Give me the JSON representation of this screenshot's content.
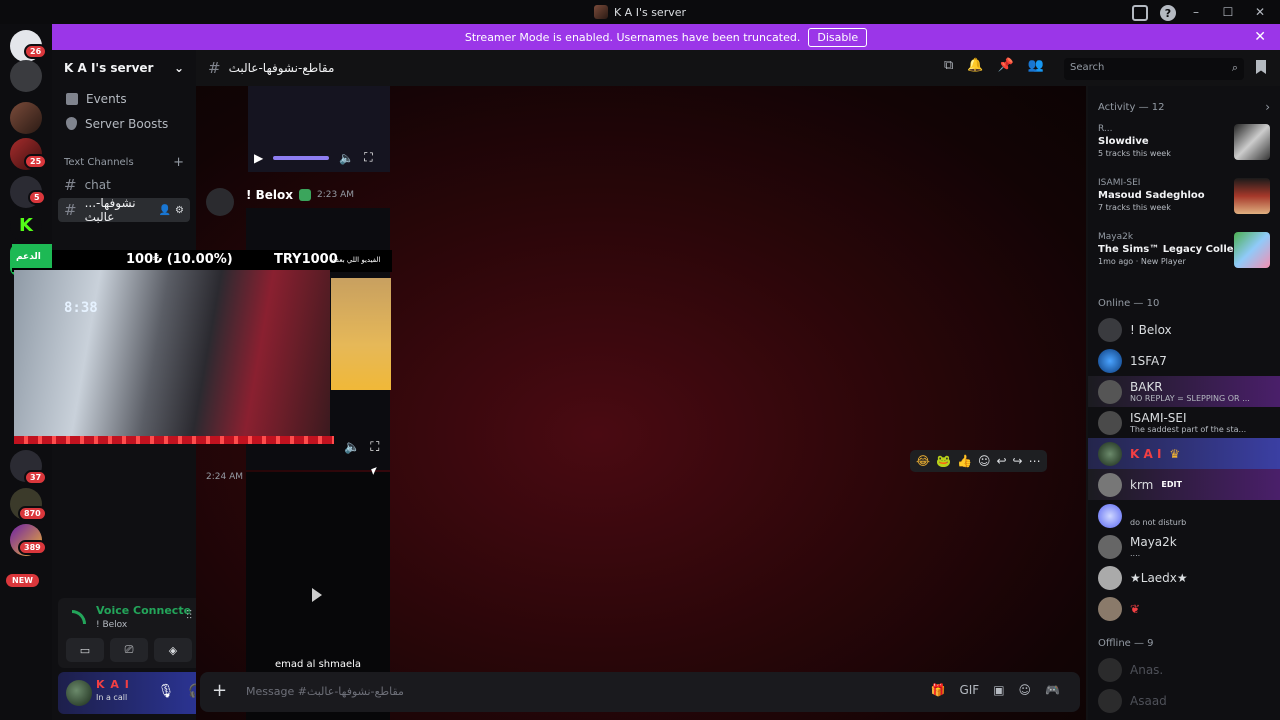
{
  "window": {
    "title": "K A I's server"
  },
  "banner": {
    "text": "Streamer Mode is enabled. Usernames have been truncated.",
    "button": "Disable"
  },
  "rail": {
    "badges": [
      "26",
      "25",
      "5",
      "37",
      "870",
      "389"
    ],
    "new_label": "NEW",
    "green_server": "الدعم"
  },
  "server": {
    "name": "K A I's server",
    "nav": [
      {
        "label": "Events"
      },
      {
        "label": "Server Boosts"
      }
    ],
    "category": "Text Channels",
    "channels": [
      {
        "label": "chat"
      },
      {
        "label": "...نشوفها-عالبث"
      }
    ]
  },
  "voice": {
    "status": "Voice Connecte",
    "channel": "! Belox"
  },
  "user": {
    "name": "K A I",
    "status": "In a call"
  },
  "channel_header": {
    "name": "مقاطع-نشوفها-عالبث",
    "search_placeholder": "Search"
  },
  "messages": [
    {
      "author": "! Belox",
      "time": "2:23 AM"
    },
    {
      "time": "2:24 AM",
      "caption": "emad al shmaela"
    }
  ],
  "stream_overlay": {
    "goal_amount": "100₺ (10.00%)",
    "tip_code": "TRY1000",
    "tip_note": "الفيديو اللي بعده",
    "clock": "8:38"
  },
  "composer": {
    "placeholder": "Message #مقاطع-نشوفها-عالبث"
  },
  "activity": {
    "header": "Activity — 12",
    "items": [
      {
        "user": "R...",
        "name": "Slowdive",
        "sub": "5 tracks this week"
      },
      {
        "user": "ISAMI-SEI",
        "name": "Masoud Sadeghloo",
        "sub": "7 tracks this week"
      },
      {
        "user": "Maya2k",
        "name": "The Sims™ Legacy Collection",
        "sub": "1mo ago",
        "sub2": "New Player"
      }
    ]
  },
  "online": {
    "header": "Online — 10",
    "members": [
      {
        "name": "! Belox",
        "status": ""
      },
      {
        "name": "1SFA7",
        "status": ""
      },
      {
        "name": "BAKR",
        "status": "NO REPLAY = SLEPPING OR ..."
      },
      {
        "name": "ISAMI-SEI",
        "status": "The saddest part of the sta..."
      },
      {
        "name": "K A I",
        "status": ""
      },
      {
        "name": "krm",
        "tag": "EDIT",
        "status": ""
      },
      {
        "name": "",
        "status": "do not disturb"
      },
      {
        "name": "Maya2k",
        "status": "...."
      },
      {
        "name": "★Laedx★",
        "status": ""
      },
      {
        "name": "",
        "status": ""
      }
    ]
  },
  "offline": {
    "header": "Offline — 9",
    "members": [
      {
        "name": "Anas."
      },
      {
        "name": "Asaad"
      }
    ]
  },
  "colors": {
    "banner": "#9b36e8",
    "online": "#23a55a",
    "accent": "#5865f2",
    "danger": "#da373c"
  }
}
